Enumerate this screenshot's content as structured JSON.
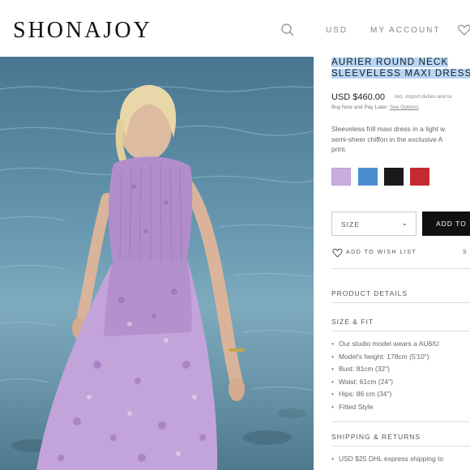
{
  "header": {
    "logo": "SHONAJOY",
    "currency": "USD",
    "account": "MY ACCOUNT"
  },
  "product": {
    "title": "AURIER ROUND NECK SLEEVELESS MAXI DRESS",
    "price": "USD $460.00",
    "price_note": "incl. import duties and ta",
    "pay_later_text": "Buy Now and Pay Later:",
    "pay_later_link": "See Options",
    "description": "Sleeveless frill maxi dress in a light w\nsemi-sheer chiffon in the exclusive A\nprint.",
    "swatches": [
      "#c8aee0",
      "#4a8ed1",
      "#1a1a1a",
      "#c42a30"
    ],
    "size_label": "SIZE",
    "add_to_cart": "ADD TO",
    "wishlist_label": "ADD TO WISH LIST",
    "share_label": "S"
  },
  "sections": {
    "product_details": "PRODUCT DETAILS",
    "size_fit": "SIZE & FIT",
    "size_fit_items": [
      "Our studio model wears a AU6/U",
      "Model's height: 178cm (5'10\")",
      "Bust: 81cm (32\")",
      "Waist: 61cm (24\")",
      "Hips: 86 cm (34\")",
      "Fitted Style"
    ],
    "shipping": "SHIPPING & RETURNS",
    "shipping_items": [
      "USD $25 DHL express shipping to"
    ]
  }
}
